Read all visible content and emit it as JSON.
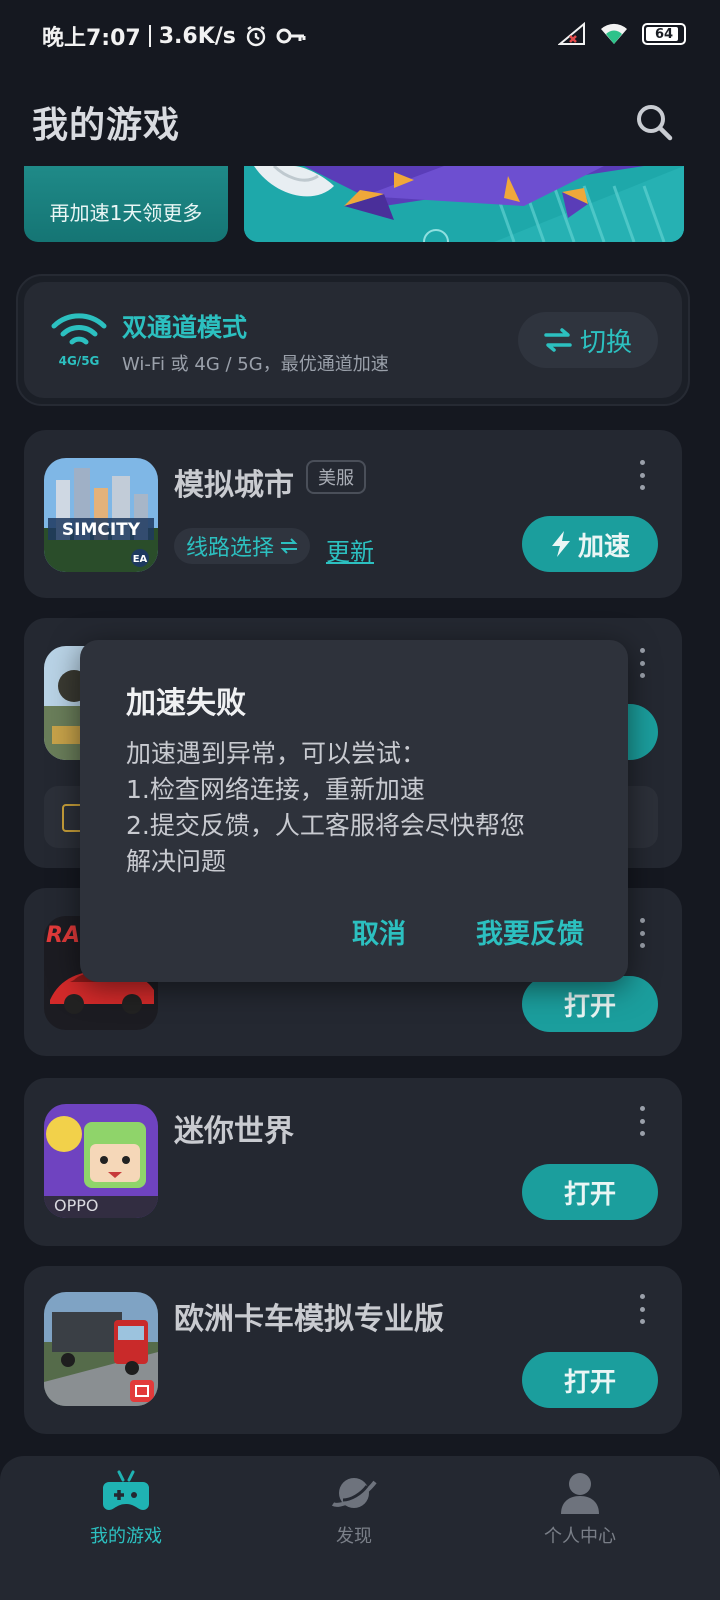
{
  "status_bar": {
    "time": "晚上7:07",
    "speed": "3.6K/s",
    "battery": "64"
  },
  "header": {
    "title": "我的游戏"
  },
  "banners": {
    "left_label": "再加速1天领更多"
  },
  "dual_channel": {
    "icon_label": "4G/5G",
    "title": "双通道模式",
    "subtitle": "Wi-Fi 或 4G / 5G，最优通道加速",
    "switch_label": "切换"
  },
  "games": [
    {
      "title": "模拟城市",
      "server_badge": "美服",
      "route_label": "线路选择",
      "update_label": "更新",
      "action_label": "加速"
    },
    {
      "title": "",
      "action_label": ""
    },
    {
      "title": "",
      "action_label": "打开"
    },
    {
      "title": "迷你世界",
      "platform_label": "OPPO",
      "action_label": "打开"
    },
    {
      "title": "欧洲卡车模拟专业版",
      "action_label": "打开"
    }
  ],
  "dialog": {
    "title": "加速失败",
    "lines": [
      "加速遇到异常，可以尝试：",
      "1.检查网络连接，重新加速",
      "2.提交反馈，人工客服将会尽快帮您",
      "解决问题"
    ],
    "cancel_label": "取消",
    "feedback_label": "我要反馈"
  },
  "bottom_nav": {
    "items": [
      {
        "label": "我的游戏",
        "active": true
      },
      {
        "label": "发现",
        "active": false
      },
      {
        "label": "个人中心",
        "active": false
      }
    ]
  },
  "colors": {
    "accent": "#2cc0c0",
    "button": "#1b9e9d",
    "background": "#151820",
    "card": "#242831"
  }
}
